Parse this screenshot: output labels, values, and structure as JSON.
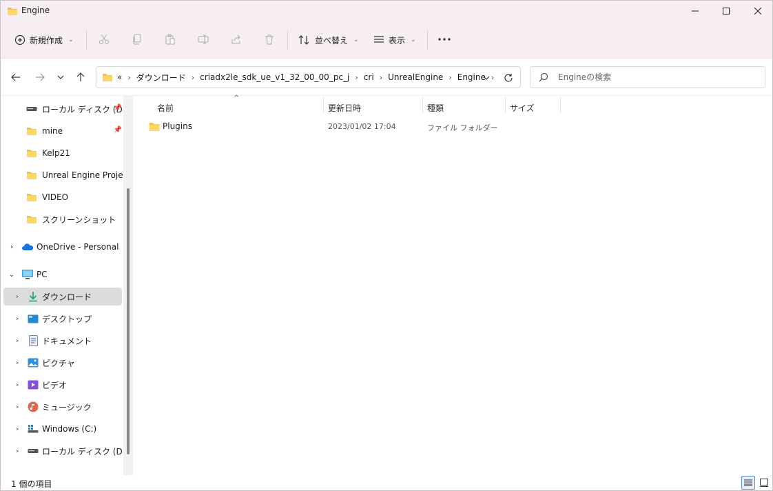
{
  "window": {
    "title": "Engine"
  },
  "toolbar": {
    "new_label": "新規作成",
    "sort_label": "並べ替え",
    "view_label": "表示",
    "icons": [
      "cut-icon",
      "copy-icon",
      "paste-icon",
      "rename-icon",
      "share-icon",
      "delete-icon"
    ]
  },
  "address": {
    "overflow": "«",
    "crumbs": [
      "ダウンロード",
      "criadx2le_sdk_ue_v1_32_00_00_pc_j",
      "cri",
      "UnrealEngine",
      "Engine"
    ]
  },
  "search": {
    "placeholder": "Engineの検索"
  },
  "sidebar": {
    "items": [
      {
        "label": "ローカル ディスク (D:)",
        "icon": "drive-icon",
        "pinned": true
      },
      {
        "label": "mine",
        "icon": "folder-icon",
        "pinned": true
      },
      {
        "label": "Kelp21",
        "icon": "folder-icon"
      },
      {
        "label": "Unreal Engine Project",
        "icon": "folder-icon"
      },
      {
        "label": "VIDEO",
        "icon": "folder-icon"
      },
      {
        "label": "スクリーンショット",
        "icon": "folder-icon"
      },
      {
        "label": "OneDrive - Personal",
        "icon": "onedrive-icon"
      },
      {
        "label": "PC",
        "icon": "pc-icon"
      },
      {
        "label": "ダウンロード",
        "icon": "download-icon",
        "selected": true
      },
      {
        "label": "デスクトップ",
        "icon": "desktop-icon"
      },
      {
        "label": "ドキュメント",
        "icon": "documents-icon"
      },
      {
        "label": "ピクチャ",
        "icon": "pictures-icon"
      },
      {
        "label": "ビデオ",
        "icon": "video-icon"
      },
      {
        "label": "ミュージック",
        "icon": "music-icon"
      },
      {
        "label": "Windows (C:)",
        "icon": "windows-drive-icon"
      },
      {
        "label": "ローカル ディスク (D:)",
        "icon": "drive-icon"
      }
    ]
  },
  "columns": {
    "name": "名前",
    "date": "更新日時",
    "type": "種類",
    "size": "サイズ"
  },
  "files": [
    {
      "name": "Plugins",
      "date": "2023/01/02 17:04",
      "type": "ファイル フォルダー",
      "size": ""
    }
  ],
  "status": {
    "count_text": "1 個の項目"
  },
  "colors": {
    "folder": "#f5c343",
    "accent": "#0067c0",
    "titlebar": "#f6eef2"
  }
}
